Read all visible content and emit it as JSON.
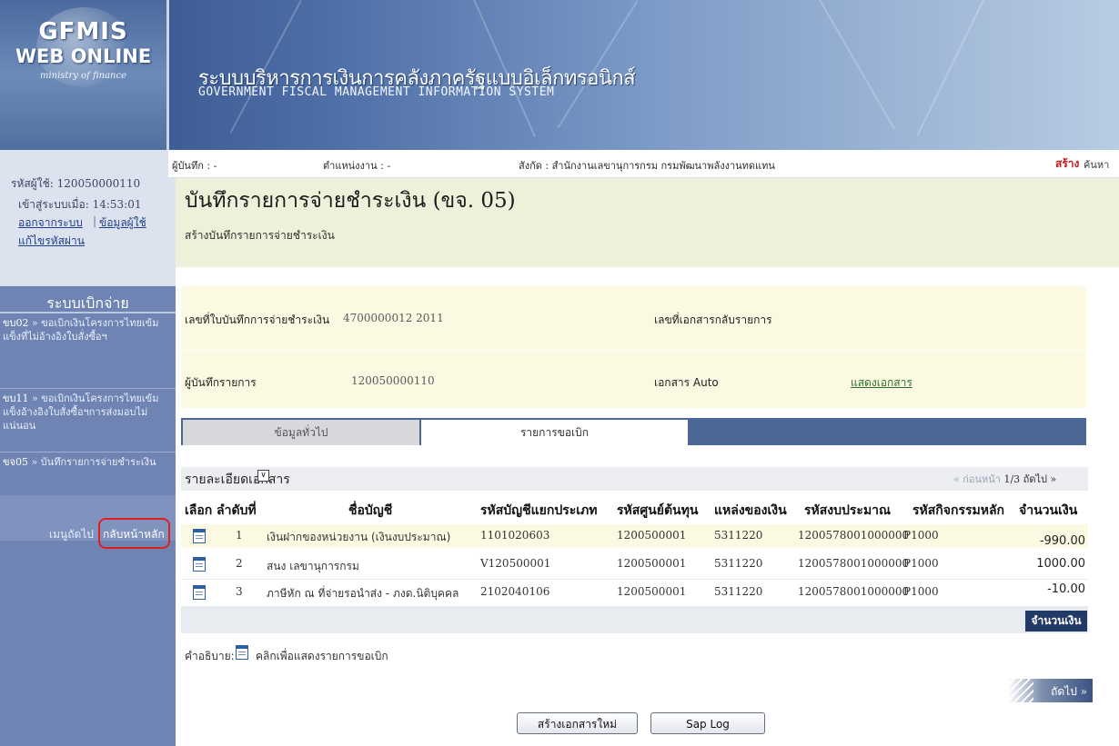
{
  "banner": {
    "logo_line1": "GFMIS",
    "logo_line2": "WEB ONLINE",
    "logo_line3": "ministry of finance",
    "title_thai": "ระบบบริหารการเงินการคลังภาครัฐแบบอิเล็กทรอนิกส์",
    "title_eng": "GOVERNMENT FISCAL MANAGEMENT INFORMATION SYSTEM"
  },
  "sidebar": {
    "user_id_label": "รหัสผู้ใช้: 120050000110",
    "login_label": "เข้าสู่ระบบเมื่อ: 14:53:01",
    "logout": "ออกจากระบบ",
    "separator": "|",
    "user_info": "ข้อมูลผู้ใช้",
    "change_password": "แก้ไขรหัสผ่าน",
    "menu_title": "ระบบเบิกจ่าย",
    "items": [
      {
        "code": "ขบ02",
        "label": "» ขอเบิกเงินโครงการไทยเข้มแข็งที่ไม่อ้างอิงใบสั่งซื้อฯ"
      },
      {
        "code": "ขบ11",
        "label": "» ขอเบิกเงินโครงการไทยเข้มแข็งอ้างอิงใบสั่งซื้อฯการส่งมอบไม่แน่นอน"
      },
      {
        "code": "ขจ05",
        "label": "» บันทึกรายการจ่ายชำระเงิน"
      }
    ],
    "nav_next": "เมนูถัดไป",
    "nav_home": "กลับหน้าหลัก"
  },
  "header": {
    "recorder": "ผู้บันทึก : -",
    "position": "ตำแหน่งงาน : -",
    "affiliation": "สังกัด : สำนักงานเลขานุการกรม กรมพัฒนาพลังงานทดแทน",
    "action_create": "สร้าง",
    "action_search": "ค้นหา"
  },
  "page": {
    "title": "บันทึกรายการจ่ายชำระเงิน (ขจ. 05)",
    "subtitle": "สร้างบันทึกรายการจ่ายชำระเงิน"
  },
  "info": {
    "doc_no_label": "เลขที่ใบบันทึกการจ่ายชำระเงิน",
    "doc_no_value": "4700000012  2011",
    "reverse_label": "เลขที่เอกสารกลับรายการ",
    "recorder_label": "ผู้บันทึกรายการ",
    "recorder_value": "120050000110",
    "auto_label": "เอกสาร Auto",
    "show_doc": "แสดงเอกสาร"
  },
  "tabs": {
    "general": "ข้อมูลทั่วไป",
    "items": "รายการขอเบิก"
  },
  "detail": {
    "title": "รายละเอียดเอกสาร",
    "pager_prev": "« ก่อนหน้า",
    "pager_page": "1/3",
    "pager_next": "ถัดไป »",
    "columns": [
      "เลือก",
      "ลำดับที่",
      "ชื่อบัญชี",
      "รหัสบัญชีแยกประเภท",
      "รหัสศูนย์ต้นทุน",
      "แหล่งของเงิน",
      "รหัสงบประมาณ",
      "รหัสกิจกรรมหลัก",
      "จำนวนเงิน"
    ],
    "rows": [
      {
        "no": "1",
        "account": "เงินฝากของหน่วยงาน (เงินงบประมาณ)",
        "gl": "1101020603",
        "cost_center": "1200500001",
        "fund": "5311220",
        "budget": "1200578001000000",
        "activity": "P1000",
        "amount": "-990.00"
      },
      {
        "no": "2",
        "account": "สนง เลขานุการกรม",
        "gl": "V120500001",
        "cost_center": "1200500001",
        "fund": "5311220",
        "budget": "1200578001000000",
        "activity": "P1000",
        "amount": "1000.00"
      },
      {
        "no": "3",
        "account": "ภาษีหัก ณ ที่จ่ายรอนำส่ง - ภงด.นิติบุคคล",
        "gl": "2102040106",
        "cost_center": "1200500001",
        "fund": "5311220",
        "budget": "1200578001000000",
        "activity": "P1000",
        "amount": "-10.00"
      }
    ],
    "net_label": "จำนวนเงินสุทธิ",
    "legend_label": "คำอธิบาย:",
    "legend_text": "คลิกเพื่อแสดงรายการขอเบิก",
    "next_button": "ถัดไป »"
  },
  "buttons": {
    "new_doc": "สร้างเอกสารใหม่",
    "sap_log": "Sap Log"
  }
}
